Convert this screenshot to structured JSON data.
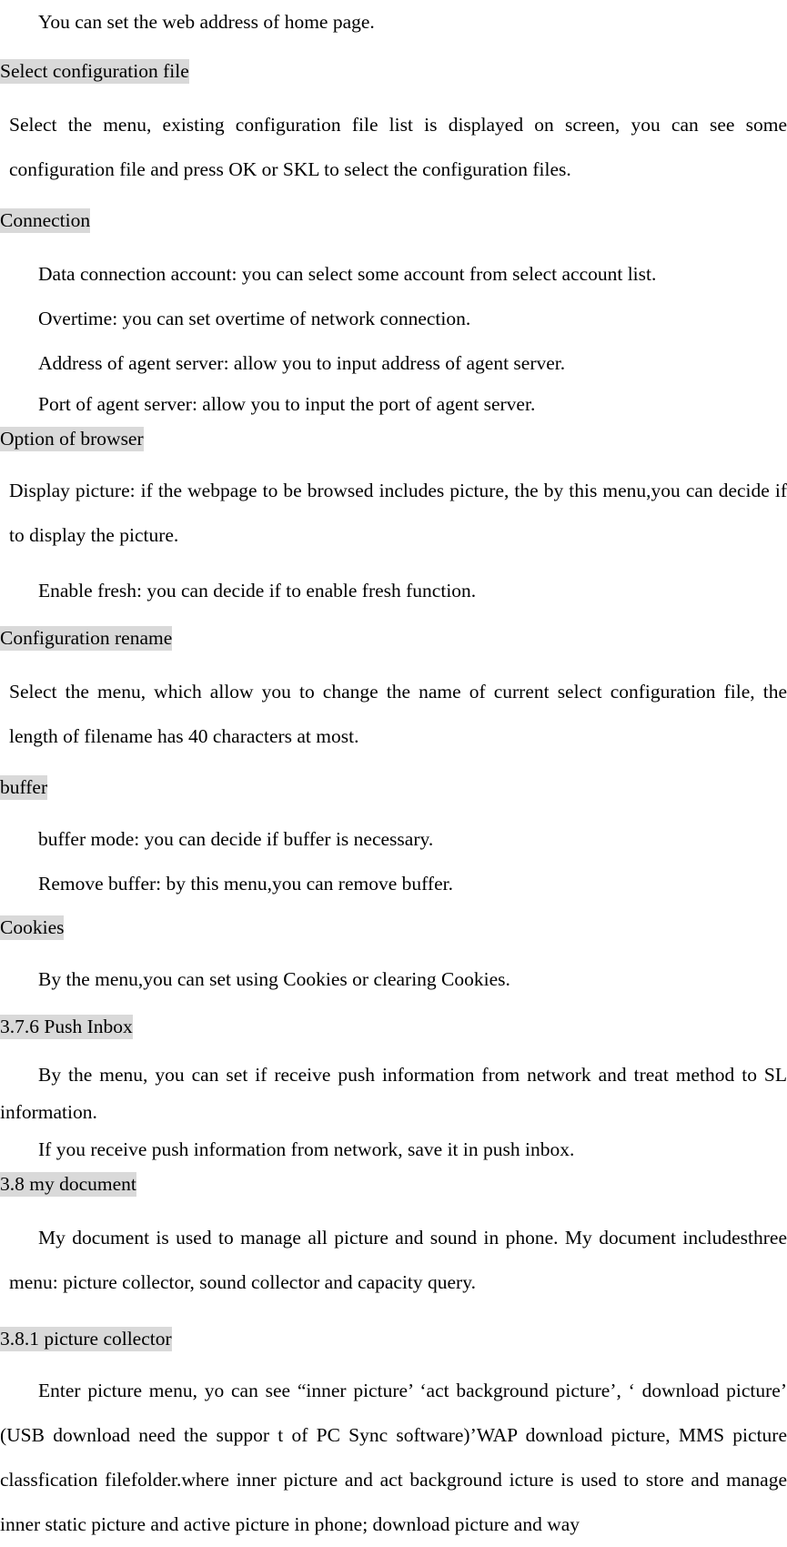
{
  "document": {
    "type": "user-manual-page",
    "highlight_color": "#d9d9d9",
    "text_color": "#000000",
    "background_color": "#ffffff"
  },
  "blocks": {
    "intro_home_page": "You can set the web address of home page.",
    "heading_select_config": "Select configuration file  ",
    "para_select_config": "Select the menu, existing configuration file list is displayed on screen, you can see some configuration file and press OK or SKL to select the configuration files.",
    "heading_connection": "Connection",
    "para_data_connection": "Data connection account: you can select some account from select account list.",
    "para_overtime": "Overtime: you can set overtime of network connection.",
    "para_address_agent": "Address of agent server: allow you to input address of agent server.",
    "para_port_agent": "Port of agent server: allow you to input the port of agent server.",
    "heading_option_browser": "Option of browser  ",
    "para_display_picture": "Display picture: if the webpage to be browsed includes picture, the by this menu,you can decide if to display the picture.",
    "para_enable_fresh": "Enable fresh: you can decide if to enable fresh function.",
    "heading_config_rename": "Configuration rename  ",
    "para_config_rename": "Select the menu, which allow you to change the name of current select configuration file, the length of filename has 40 characters at most.",
    "heading_buffer": "buffer",
    "para_buffer_mode": "buffer mode: you can decide if buffer is necessary.",
    "para_remove_buffer": "Remove buffer: by this menu,you can remove buffer.",
    "heading_cookies": "Cookies",
    "para_cookies": "By the menu,you can set using Cookies or clearing Cookies.",
    "heading_push_inbox": "3.7.6 Push Inbox",
    "para_push_inbox": "By the menu, you can set if receive push information from network and treat method to SL information.",
    "para_push_save": "If you receive push information from network, save it in push inbox.",
    "heading_my_document": "3.8 my document  ",
    "para_my_document": "My document is used to manage all picture and sound in phone. My document includesthree menu: picture collector, sound collector and capacity query.",
    "heading_picture_collector": "3.8.1 picture collector",
    "para_picture_collector": "Enter picture menu, yo can see “inner picture’ ‘act background picture’, ‘ download picture’ (USB download need the suppor t of PC Sync software)’WAP download picture, MMS picture classfication filefolder.where inner picture and act background icture is used to store and manage inner static picture and active picture in phone; download picture and way"
  }
}
